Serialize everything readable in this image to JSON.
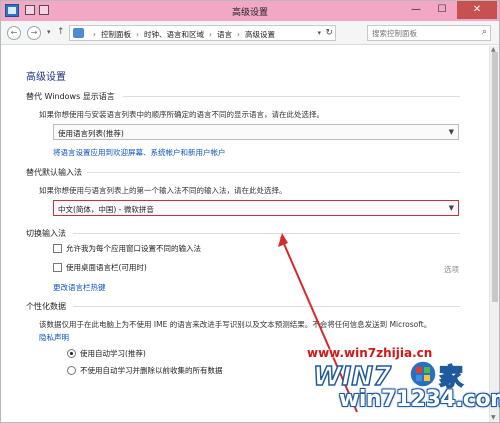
{
  "window": {
    "title": "高级设置",
    "buttons": {
      "minimize": "—",
      "maximize": "☐",
      "close": "✕"
    }
  },
  "addressbar": {
    "breadcrumb": [
      "控制面板",
      "时钟、语言和区域",
      "语言",
      "高级设置"
    ],
    "search_placeholder": "搜索控制面板"
  },
  "page": {
    "title": "高级设置",
    "override_display": {
      "heading": "替代 Windows 显示语言",
      "desc": "如果你想使用与安装语言列表中的顺序所确定的语言不同的显示语言，请在此处选择。",
      "dropdown_value": "使用语言列表(推荐)",
      "link": "将语言设置应用到欢迎屏幕、系统帐户和新用户帐户"
    },
    "override_input": {
      "heading": "替代默认输入法",
      "desc": "如果你想使用与语言列表上的第一个输入法不同的输入法，请在此处选择。",
      "dropdown_value": "中文(简体，中国) - 微软拼音"
    },
    "switch_input": {
      "heading": "切换输入法",
      "checkbox1": "允许我为每个应用窗口设置不同的输入法",
      "checkbox2": "使用桌面语言栏(可用时)",
      "options": "选项",
      "link": "更改语言栏热键"
    },
    "personalization": {
      "heading": "个性化数据",
      "desc": "该数据仅用于在此电脑上为不使用 IME 的语言来改进手写识别以及文本预测结果。不会将任何信息发送到 Microsoft。",
      "privacy_link": "隐私声明",
      "radio1": "使用自动学习(推荐)",
      "radio2": "不使用自动学习并删除以前收集的所有数据"
    }
  },
  "watermark": {
    "url": "www.win7zhijia.cn",
    "brand": "WIN7",
    "brand_suffix": "家",
    "number_site": "win71234.com"
  },
  "colors": {
    "titlebar": "#f2a7c4",
    "link": "#0b55c4",
    "heading": "#1e3287",
    "focus_border": "#c7313e",
    "arrow": "#d42a2a"
  }
}
